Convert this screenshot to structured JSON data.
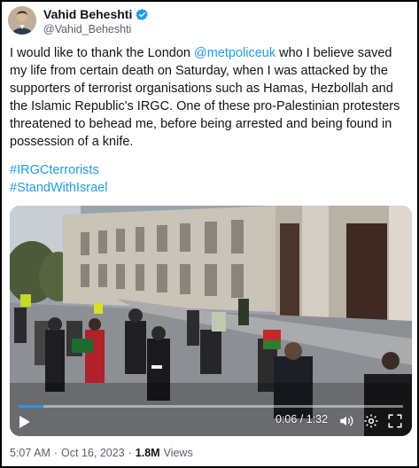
{
  "author": {
    "name": "Vahid Beheshti",
    "handle": "@Vahid_Beheshti",
    "verified_color": "#1d9bf0"
  },
  "tweet": {
    "text_before_mention": "I would like to thank the London ",
    "mention": "@metpoliceuk",
    "text_after_mention": " who I believe saved my life from certain death on Saturday, when I was attacked by the supporters of terrorist organisations such as Hamas, Hezbollah and the Islamic Republic's IRGC. One of these pro-Palestinian protesters threatened to behead me, before being arrested and being found in possession of a knife.",
    "hashtags": [
      "#IRGCterrorists",
      "#StandWithIsrael"
    ]
  },
  "video": {
    "time_display": "0:06 / 1:32",
    "progress_fraction": 0.065,
    "icons": [
      "play-icon",
      "volume-icon",
      "settings-icon",
      "fullscreen-icon"
    ]
  },
  "footer": {
    "time": "5:07 AM",
    "separator": "·",
    "date": "Oct 16, 2023",
    "views_count": "1.8M",
    "views_label": "Views"
  },
  "colors": {
    "link": "#1d9bf0",
    "secondary_text": "#536471",
    "primary_text": "#0f1419"
  }
}
